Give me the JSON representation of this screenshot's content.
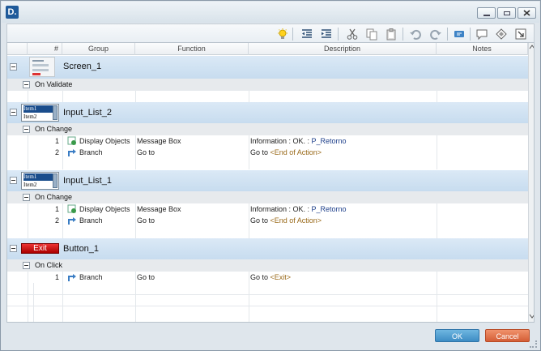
{
  "titlebar": {
    "app_icon": "D."
  },
  "toolbar": {
    "icons": [
      "lightbulb-icon",
      "outdent-icon",
      "indent-icon",
      "cut-icon",
      "copy-icon",
      "paste-icon",
      "undo-icon",
      "redo-icon",
      "comment-icon",
      "note-icon",
      "diamond-icon",
      "export-icon"
    ]
  },
  "grid": {
    "headers": {
      "num": "#",
      "group": "Group",
      "function": "Function",
      "description": "Description",
      "notes": "Notes"
    },
    "objects": [
      {
        "name": "Screen_1",
        "event": "On Validate",
        "actions": []
      },
      {
        "name": "Input_List_2",
        "event": "On Change",
        "thumb": [
          "Item1",
          "Item2"
        ],
        "actions": [
          {
            "num": "1",
            "group": "Display Objects",
            "function": "Message Box",
            "desc_prefix": "Information : OK. : ",
            "desc_var": "P_Retorno",
            "desc_tag": ""
          },
          {
            "num": "2",
            "group": "Branch",
            "function": "Go to",
            "desc_prefix": "Go to ",
            "desc_var": "",
            "desc_tag": "<End of Action>"
          }
        ]
      },
      {
        "name": "Input_List_1",
        "event": "On Change",
        "thumb": [
          "Item1",
          "Item2"
        ],
        "actions": [
          {
            "num": "1",
            "group": "Display Objects",
            "function": "Message Box",
            "desc_prefix": "Information : OK. : ",
            "desc_var": "P_Retorno",
            "desc_tag": ""
          },
          {
            "num": "2",
            "group": "Branch",
            "function": "Go to",
            "desc_prefix": "Go to ",
            "desc_var": "",
            "desc_tag": "<End of Action>"
          }
        ]
      },
      {
        "name": "Button_1",
        "event": "On Click",
        "button_label": "Exit",
        "actions": [
          {
            "num": "1",
            "group": "Branch",
            "function": "Go to",
            "desc_prefix": "Go to ",
            "desc_var": "",
            "desc_tag": "<Exit>"
          }
        ]
      }
    ]
  },
  "footer": {
    "ok": "OK",
    "cancel": "Cancel"
  }
}
